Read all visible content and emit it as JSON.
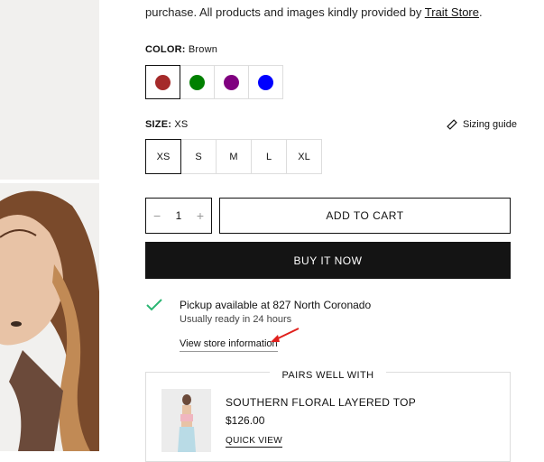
{
  "intro": {
    "text": "purchase. All products and images kindly provided by ",
    "link": "Trait Store",
    "end": "."
  },
  "color": {
    "label": "COLOR:",
    "value": "Brown",
    "swatches": [
      {
        "name": "Brown",
        "hex": "#a52a2a",
        "selected": true
      },
      {
        "name": "Green",
        "hex": "#008000",
        "selected": false
      },
      {
        "name": "Purple",
        "hex": "#800080",
        "selected": false
      },
      {
        "name": "Blue",
        "hex": "#0000ff",
        "selected": false
      }
    ]
  },
  "size": {
    "label": "SIZE:",
    "value": "XS",
    "sizing_guide": "Sizing guide",
    "options": [
      "XS",
      "S",
      "M",
      "L",
      "XL"
    ]
  },
  "quantity": {
    "value": "1",
    "minus": "−",
    "plus": "+"
  },
  "add_to_cart": "ADD TO CART",
  "buy_now": "BUY IT NOW",
  "pickup": {
    "line_prefix": "Pickup available at ",
    "location": "827 North Coronado",
    "ready": "Usually ready in 24 hours",
    "store_link": "View store information",
    "check_color": "#2bb673"
  },
  "pairs": {
    "title": "PAIRS WELL WITH",
    "product_name": "SOUTHERN FLORAL LAYERED TOP",
    "price": "$126.00",
    "quick_view": "QUICK VIEW"
  },
  "annotation_color": "#e0201c"
}
